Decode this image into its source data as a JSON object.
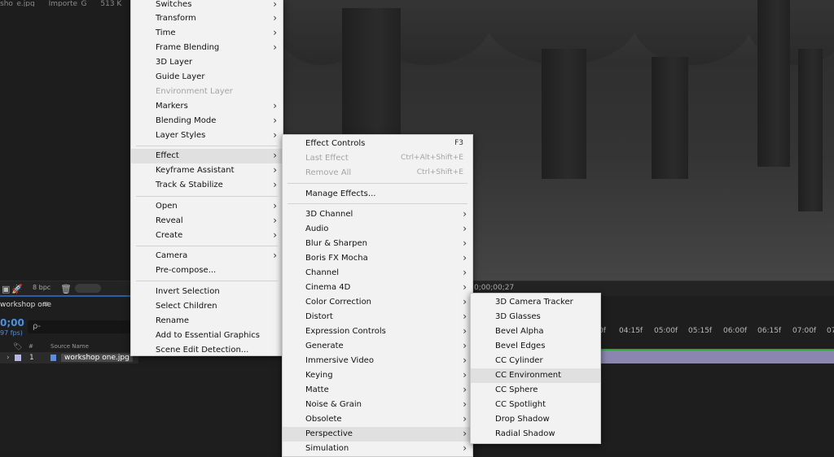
{
  "project": {
    "strip": [
      "sho_e.jpg",
      "Importe_G",
      "513 K"
    ]
  },
  "statusbar": {
    "bpc": "8 bpc",
    "timecode": "0;00;00;27"
  },
  "timeline": {
    "tab_title": "workshop one",
    "tab_menu_icon": "≡",
    "current_time": "0;00",
    "fps": "97 fps)",
    "search_placeholder": "ρ-",
    "columns": {
      "num": "#",
      "source": "Source Name"
    },
    "layer": {
      "index": "1",
      "name": "workshop one.jpg"
    },
    "ruler": [
      "0f",
      "04:15f",
      "05:00f",
      "05:15f",
      "06:00f",
      "06:15f",
      "07:00f",
      "07"
    ]
  },
  "context_menu": {
    "items": [
      {
        "label": "Switches",
        "arrow": "›"
      },
      {
        "label": "Transform",
        "arrow": "›"
      },
      {
        "label": "Time",
        "arrow": "›"
      },
      {
        "label": "Frame Blending",
        "arrow": "›"
      },
      {
        "label": "3D Layer"
      },
      {
        "label": "Guide Layer"
      },
      {
        "label": "Environment Layer",
        "disabled": true
      },
      {
        "label": "Markers",
        "arrow": "›"
      },
      {
        "label": "Blending Mode",
        "arrow": "›"
      },
      {
        "label": "Layer Styles",
        "arrow": "›"
      },
      {
        "label": "Effect",
        "arrow": "›",
        "highlight": true
      },
      {
        "label": "Keyframe Assistant",
        "arrow": "›"
      },
      {
        "label": "Track & Stabilize",
        "arrow": "›"
      },
      {
        "label": "Open",
        "arrow": "›"
      },
      {
        "label": "Reveal",
        "arrow": "›"
      },
      {
        "label": "Create",
        "arrow": "›"
      },
      {
        "label": "Camera",
        "arrow": "›"
      },
      {
        "label": "Pre-compose..."
      },
      {
        "label": "Invert Selection"
      },
      {
        "label": "Select Children"
      },
      {
        "label": "Rename"
      },
      {
        "label": "Add to Essential Graphics"
      },
      {
        "label": "Scene Edit Detection..."
      }
    ]
  },
  "effect_menu": {
    "items": [
      {
        "label": "Effect Controls",
        "shortcut": "F3"
      },
      {
        "label": "Last Effect",
        "shortcut": "Ctrl+Alt+Shift+E",
        "disabled": true
      },
      {
        "label": "Remove All",
        "shortcut": "Ctrl+Shift+E",
        "disabled": true
      },
      {
        "label": "Manage Effects..."
      },
      {
        "label": "3D Channel",
        "arrow": "›"
      },
      {
        "label": "Audio",
        "arrow": "›"
      },
      {
        "label": "Blur & Sharpen",
        "arrow": "›"
      },
      {
        "label": "Boris FX Mocha",
        "arrow": "›"
      },
      {
        "label": "Channel",
        "arrow": "›"
      },
      {
        "label": "Cinema 4D",
        "arrow": "›"
      },
      {
        "label": "Color Correction",
        "arrow": "›"
      },
      {
        "label": "Distort",
        "arrow": "›"
      },
      {
        "label": "Expression Controls",
        "arrow": "›"
      },
      {
        "label": "Generate",
        "arrow": "›"
      },
      {
        "label": "Immersive Video",
        "arrow": "›"
      },
      {
        "label": "Keying",
        "arrow": "›"
      },
      {
        "label": "Matte",
        "arrow": "›"
      },
      {
        "label": "Noise & Grain",
        "arrow": "›"
      },
      {
        "label": "Obsolete",
        "arrow": "›"
      },
      {
        "label": "Perspective",
        "arrow": "›",
        "highlight": true
      },
      {
        "label": "Simulation",
        "arrow": "›"
      }
    ]
  },
  "perspective_menu": {
    "items": [
      {
        "label": "3D Camera Tracker"
      },
      {
        "label": "3D Glasses"
      },
      {
        "label": "Bevel Alpha"
      },
      {
        "label": "Bevel Edges"
      },
      {
        "label": "CC Cylinder"
      },
      {
        "label": "CC Environment",
        "highlight": true
      },
      {
        "label": "CC Sphere"
      },
      {
        "label": "CC Spotlight"
      },
      {
        "label": "Drop Shadow"
      },
      {
        "label": "Radial Shadow"
      }
    ]
  }
}
